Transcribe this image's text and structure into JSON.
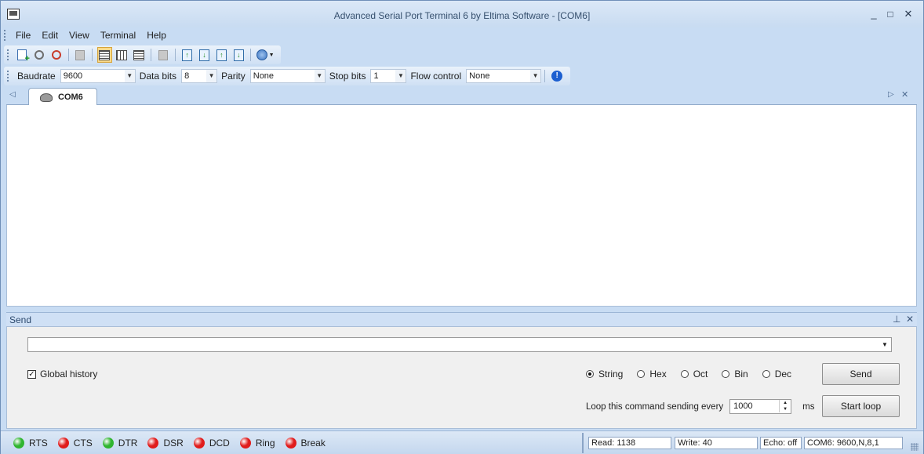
{
  "window": {
    "title": "Advanced Serial Port Terminal 6 by Eltima Software - [COM6]",
    "minimize_glyph": "_",
    "maximize_glyph": "□",
    "close_glyph": "✕"
  },
  "menu": [
    "File",
    "Edit",
    "View",
    "Terminal",
    "Help"
  ],
  "toolbar": {
    "icons": [
      "new-session-icon",
      "search-icon",
      "disconnect-icon",
      "copy-icon",
      "text-view-icon",
      "hex-view-icon",
      "table-view-icon",
      "clear-icon",
      "send-file-icon",
      "receive-file-icon",
      "send-data-icon",
      "receive-data-icon",
      "help-icon"
    ]
  },
  "port_settings": {
    "baudrate_label": "Baudrate",
    "baudrate_value": "9600",
    "databits_label": "Data bits",
    "databits_value": "8",
    "parity_label": "Parity",
    "parity_value": "None",
    "stopbits_label": "Stop bits",
    "stopbits_value": "1",
    "flow_label": "Flow control",
    "flow_value": "None"
  },
  "tabs": [
    {
      "label": "COM6"
    }
  ],
  "send_panel": {
    "title": "Send",
    "input_value": "",
    "global_history_label": "Global history",
    "global_history_checked": true,
    "formats": [
      {
        "label": "String",
        "selected": true
      },
      {
        "label": "Hex",
        "selected": false
      },
      {
        "label": "Oct",
        "selected": false
      },
      {
        "label": "Bin",
        "selected": false
      },
      {
        "label": "Dec",
        "selected": false
      }
    ],
    "send_button": "Send",
    "loop_label": "Loop this command sending every",
    "loop_value": "1000",
    "loop_unit": "ms",
    "start_loop_button": "Start loop"
  },
  "status": {
    "signals": [
      {
        "label": "RTS",
        "color": "#2fb52f"
      },
      {
        "label": "CTS",
        "color": "#e01c1c"
      },
      {
        "label": "DTR",
        "color": "#2fb52f"
      },
      {
        "label": "DSR",
        "color": "#e01c1c"
      },
      {
        "label": "DCD",
        "color": "#e01c1c"
      },
      {
        "label": "Ring",
        "color": "#e01c1c"
      },
      {
        "label": "Break",
        "color": "#e01c1c"
      }
    ],
    "read": "Read:  1138",
    "write": "Write:  40",
    "echo": "Echo: off",
    "port_info": "COM6: 9600,N,8,1"
  }
}
